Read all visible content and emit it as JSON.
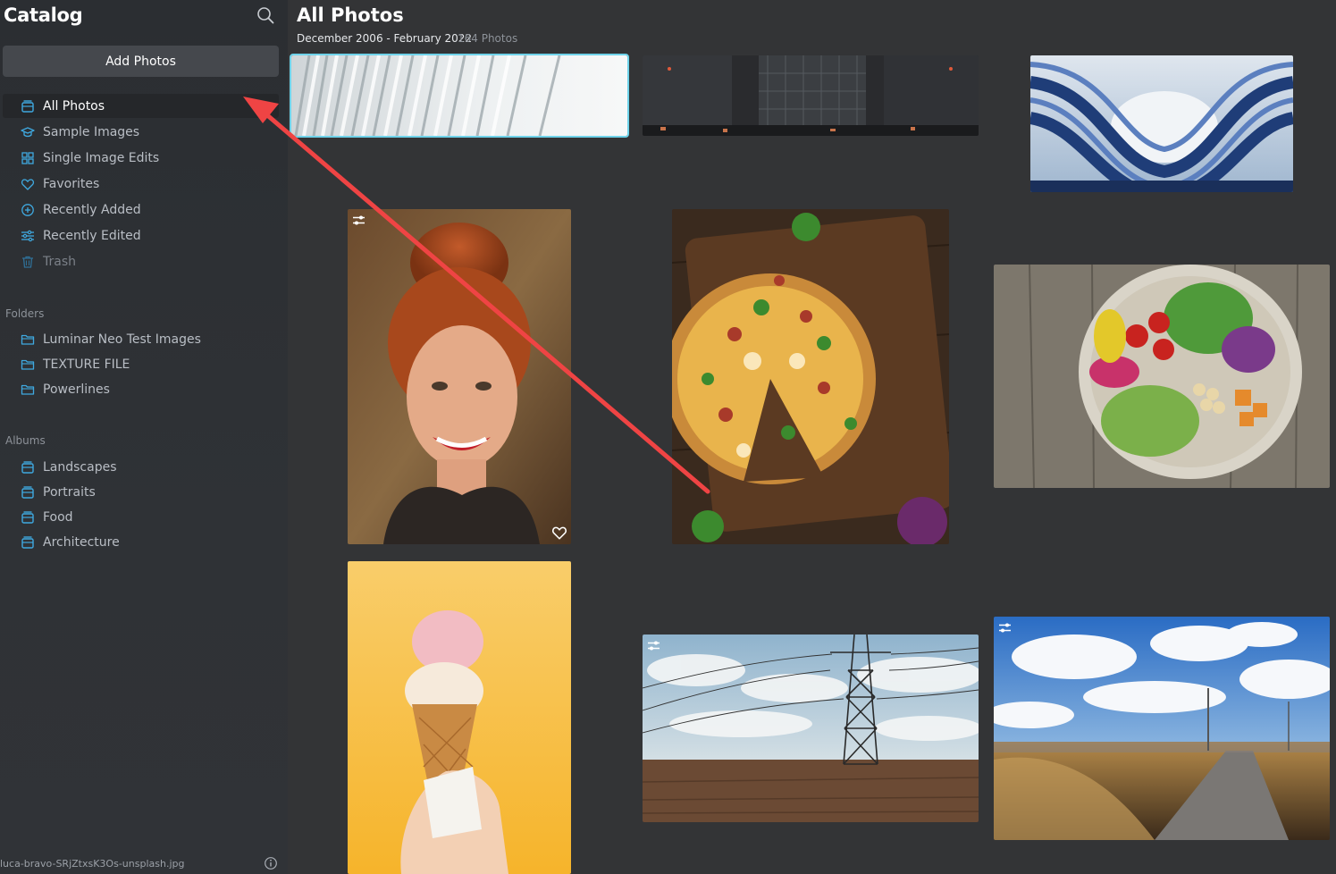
{
  "sidebar": {
    "title": "Catalog",
    "add_button": "Add Photos",
    "nav": [
      {
        "label": "All Photos",
        "icon": "all-photos-icon"
      },
      {
        "label": "Sample Images",
        "icon": "graduation-cap-icon"
      },
      {
        "label": "Single Image Edits",
        "icon": "grid-icon"
      },
      {
        "label": "Favorites",
        "icon": "heart-icon"
      },
      {
        "label": "Recently Added",
        "icon": "plus-circle-icon"
      },
      {
        "label": "Recently Edited",
        "icon": "sliders-icon"
      },
      {
        "label": "Trash",
        "icon": "trash-icon"
      }
    ],
    "folders_label": "Folders",
    "folders": [
      {
        "label": "Luminar Neo Test Images"
      },
      {
        "label": "TEXTURE FILE"
      },
      {
        "label": "Powerlines"
      }
    ],
    "albums_label": "Albums",
    "albums": [
      {
        "label": "Landscapes"
      },
      {
        "label": "Portraits"
      },
      {
        "label": "Food"
      },
      {
        "label": "Architecture"
      }
    ],
    "filename": "luca-bravo-SRjZtxsK3Os-unsplash.jpg"
  },
  "main": {
    "title": "All Photos",
    "date_range": "December 2006 - February 2022",
    "photo_count": "164 Photos"
  },
  "colors": {
    "accent": "#6fd3ea",
    "icon_blue": "#3fa9e0",
    "annotation_arrow": "#ef4444"
  }
}
